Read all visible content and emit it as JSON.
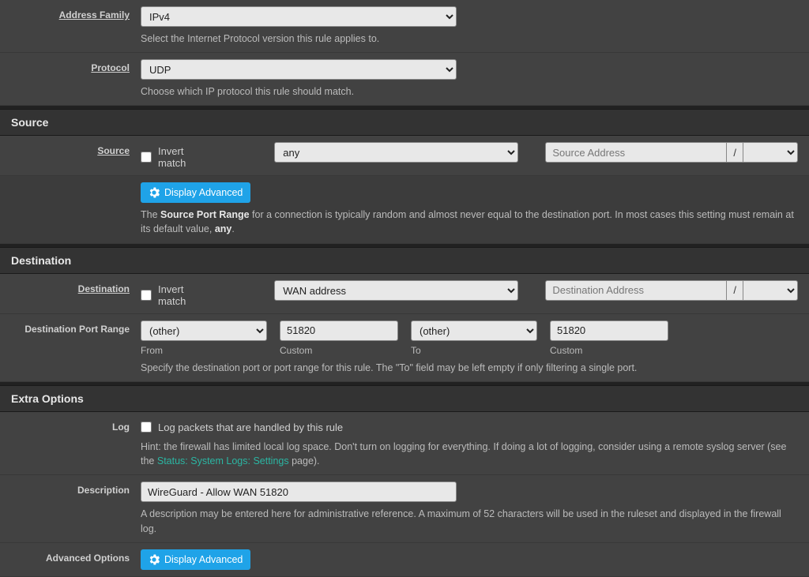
{
  "addressFamily": {
    "label": "Address Family",
    "value": "IPv4",
    "help": "Select the Internet Protocol version this rule applies to."
  },
  "protocol": {
    "label": "Protocol",
    "value": "UDP",
    "help": "Choose which IP protocol this rule should match."
  },
  "sourceSection": {
    "header": "Source",
    "label": "Source",
    "invertLabel": "Invert match",
    "typeValue": "any",
    "addrPlaceholder": "Source Address",
    "slash": "/",
    "btnAdvanced": "Display Advanced",
    "helpPrefix": "The ",
    "helpBold": "Source Port Range",
    "helpMid": " for a connection is typically random and almost never equal to the destination port. In most cases this setting must remain at its default value, ",
    "helpBold2": "any",
    "helpSuffix": "."
  },
  "destSection": {
    "header": "Destination",
    "label": "Destination",
    "invertLabel": "Invert match",
    "typeValue": "WAN address",
    "addrPlaceholder": "Destination Address",
    "slash": "/",
    "portRangeLabel": "Destination Port Range",
    "fromSelect": "(other)",
    "fromCustom": "51820",
    "toSelect": "(other)",
    "toCustom": "51820",
    "colFrom": "From",
    "colCustom": "Custom",
    "colTo": "To",
    "colCustom2": "Custom",
    "help": "Specify the destination port or port range for this rule. The \"To\" field may be left empty if only filtering a single port."
  },
  "extraSection": {
    "header": "Extra Options",
    "logLabel": "Log",
    "logCheckbox": "Log packets that are handled by this rule",
    "logHintPrefix": "Hint: the firewall has limited local log space. Don't turn on logging for everything. If doing a lot of logging, consider using a remote syslog server (see the ",
    "logHintLink": "Status: System Logs: Settings",
    "logHintSuffix": " page).",
    "descLabel": "Description",
    "descValue": "WireGuard - Allow WAN 51820",
    "descHelp": "A description may be entered here for administrative reference. A maximum of 52 characters will be used in the ruleset and displayed in the firewall log.",
    "advLabel": "Advanced Options",
    "btnAdvanced": "Display Advanced"
  }
}
